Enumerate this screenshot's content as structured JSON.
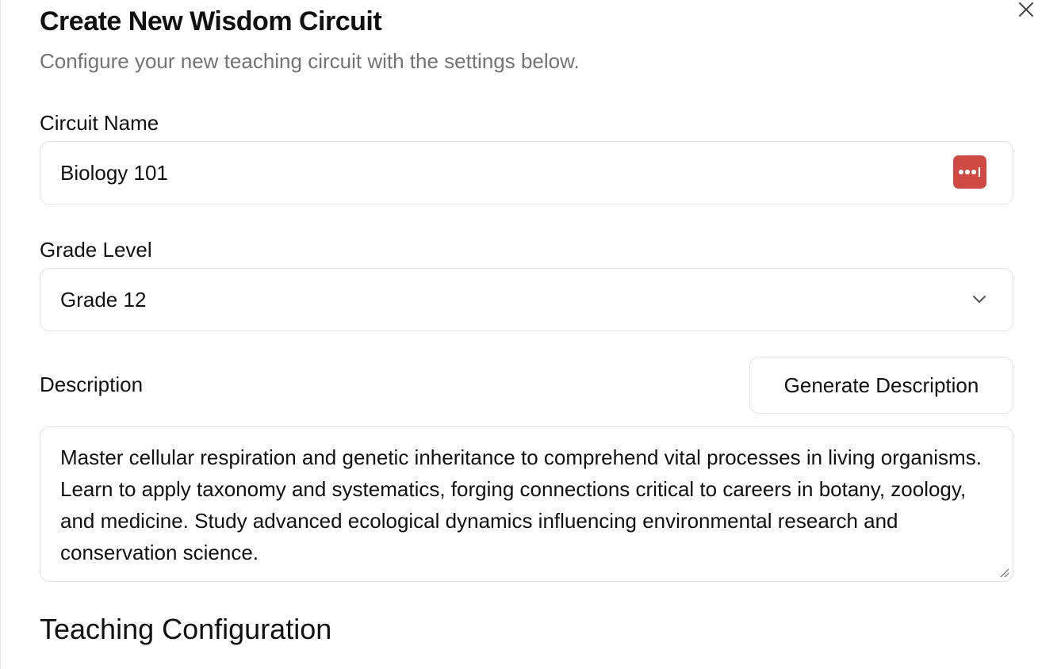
{
  "dialog": {
    "title": "Create New Wisdom Circuit",
    "subtitle": "Configure your new teaching circuit with the settings below.",
    "close_icon": "close-icon"
  },
  "form": {
    "circuit_name": {
      "label": "Circuit Name",
      "value": "Biology 101",
      "password_manager_icon": "password-manager-icon"
    },
    "grade_level": {
      "label": "Grade Level",
      "value": "Grade 12",
      "dropdown_icon": "chevron-down-icon"
    },
    "description": {
      "label": "Description",
      "generate_button_label": "Generate Description",
      "value": "Master cellular respiration and genetic inheritance to comprehend vital processes in living organisms. Learn to apply taxonomy and systematics, forging connections critical to careers in botany, zoology, and medicine. Study advanced ecological dynamics influencing environmental research and conservation science."
    }
  },
  "sections": {
    "teaching_configuration": "Teaching Configuration"
  },
  "colors": {
    "accent_badge": "#cf4a42",
    "muted_text": "#737373",
    "border": "#e3e3e3"
  }
}
